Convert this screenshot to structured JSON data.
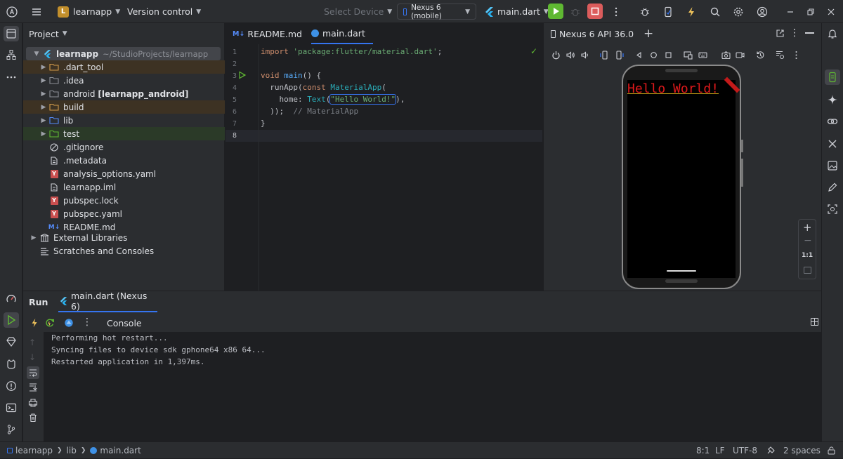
{
  "titlebar": {
    "project_badge": "L",
    "project_name": "learnapp",
    "vcs": "Version control",
    "select_device": "Select Device",
    "device": "Nexus 6 (mobile)",
    "run_config": "main.dart"
  },
  "project_panel": {
    "title": "Project",
    "root": {
      "name": "learnapp",
      "path": "~/StudioProjects/learnapp"
    },
    "items": [
      {
        "label": ".dart_tool",
        "type": "folder-orange"
      },
      {
        "label": ".idea",
        "type": "folder"
      },
      {
        "label": "android",
        "bold": "[learnapp_android]",
        "type": "folder"
      },
      {
        "label": "build",
        "type": "folder-orange"
      },
      {
        "label": "lib",
        "type": "folder-blue"
      },
      {
        "label": "test",
        "type": "folder-green"
      },
      {
        "label": ".gitignore",
        "type": "gitignore"
      },
      {
        "label": ".metadata",
        "type": "file"
      },
      {
        "label": "analysis_options.yaml",
        "type": "yaml"
      },
      {
        "label": "learnapp.iml",
        "type": "file"
      },
      {
        "label": "pubspec.lock",
        "type": "yaml"
      },
      {
        "label": "pubspec.yaml",
        "type": "yaml"
      },
      {
        "label": "README.md",
        "type": "md"
      }
    ],
    "external": "External Libraries",
    "scratches": "Scratches and Consoles"
  },
  "editor": {
    "tabs": [
      {
        "label": "README.md",
        "prefix": "M↓"
      },
      {
        "label": "main.dart"
      }
    ],
    "line_numbers": [
      "1",
      "2",
      "3",
      "4",
      "5",
      "6",
      "7",
      "8"
    ],
    "code": {
      "l1_kw": "import",
      "l1_str": "'package:flutter/material.dart'",
      "l1_end": ";",
      "l3_kw": "void",
      "l3_fn": "main",
      "l3_end": "() {",
      "l4_a": "  runApp(",
      "l4_kw": "const",
      "l4_cls": "MaterialApp",
      "l4_end": "(",
      "l5_a": "    home: ",
      "l5_cls": "Text",
      "l5_p": "(",
      "l5_str": "\"Hello World!\"",
      "l5_end": "),",
      "l6_a": "  ));",
      "l6_cm": "  // MaterialApp",
      "l7": "}"
    }
  },
  "emulator": {
    "tab": "Nexus 6 API 36.0",
    "screen_text": "Hello World!",
    "zoom_label": "1:1"
  },
  "run_panel": {
    "title": "Run",
    "tab": "main.dart (Nexus 6)",
    "console_label": "Console",
    "lines": [
      "Performing hot restart...",
      "Syncing files to device sdk gphone64 x86 64...",
      "Restarted application in 1,397ms."
    ]
  },
  "statusbar": {
    "crumbs": [
      "learnapp",
      "lib",
      "main.dart"
    ],
    "position": "8:1",
    "line_sep": "LF",
    "encoding": "UTF-8",
    "indent": "2 spaces"
  },
  "colors": {
    "accent_blue": "#3574f0",
    "run_green": "#5fb832",
    "stop_red": "#db5c5c",
    "hello_red": "#e0191b"
  }
}
